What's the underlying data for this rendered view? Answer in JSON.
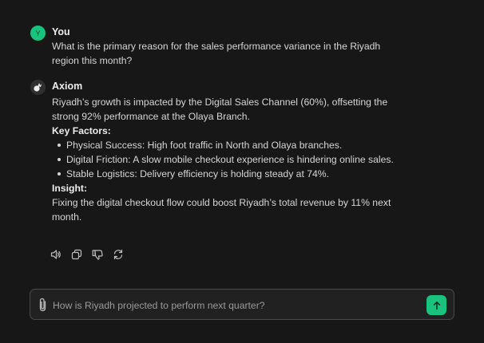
{
  "user_message": {
    "avatar_letter": "Y",
    "sender": "You",
    "text": "What is the primary reason for the sales performance variance in the Riyadh region this month?"
  },
  "assistant_message": {
    "sender": "Axiom",
    "intro": "Riyadh’s growth is impacted by the Digital Sales Channel (60%), offsetting the strong 92% performance at the Olaya Branch.",
    "key_factors_title": "Key Factors:",
    "factors": [
      "Physical Success: High foot traffic in North and Olaya branches.",
      "Digital Friction: A slow mobile checkout experience is hindering online sales.",
      "Stable Logistics: Delivery efficiency is holding steady at 74%."
    ],
    "insight_title": "Insight:",
    "insight": "Fixing the digital checkout flow could boost Riyadh’s total revenue by 11% next month."
  },
  "actions": {
    "icons": [
      "speaker-icon",
      "copy-icon",
      "thumbs-down-icon",
      "regenerate-icon"
    ]
  },
  "composer": {
    "placeholder": "How is Riyadh projected to perform next quarter?",
    "value": ""
  },
  "colors": {
    "background": "#171717",
    "accent": "#19c37d",
    "composer_bg": "#212121",
    "composer_border": "#4a4a4a"
  }
}
